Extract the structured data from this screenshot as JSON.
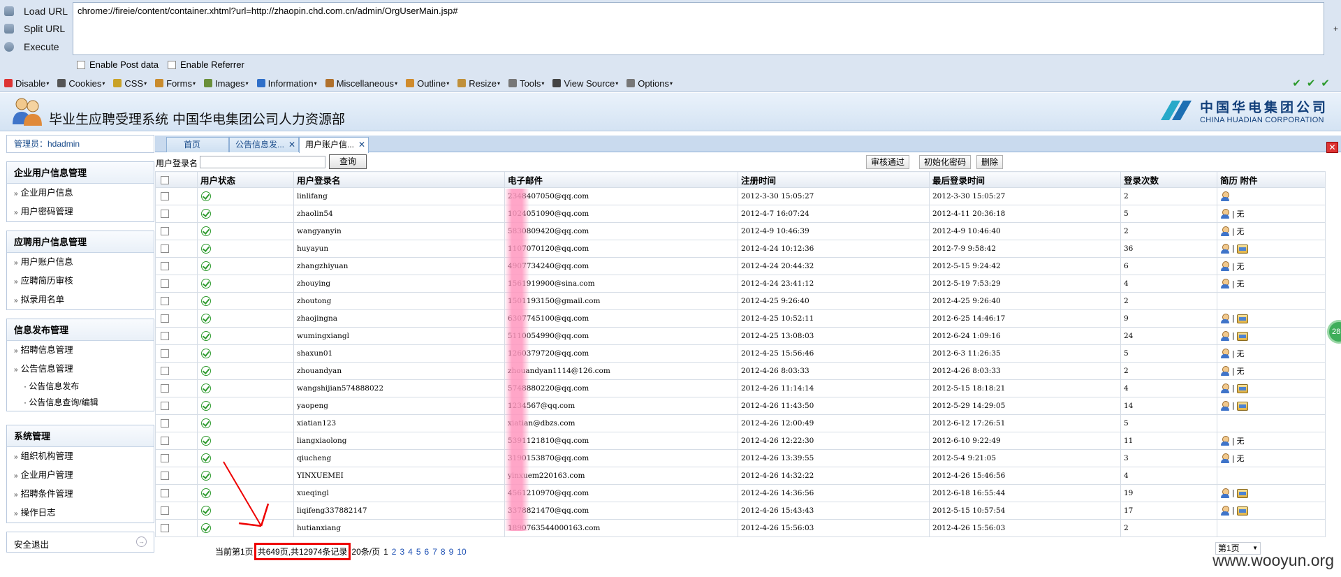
{
  "hackbar": {
    "load_url": "Load URL",
    "split_url": "Split URL",
    "execute": "Execute",
    "url_value": "chrome://fireie/content/container.xhtml?url=http://zhaopin.chd.com.cn/admin/OrgUserMain.jsp#",
    "plus": "+",
    "enable_post": "Enable Post data",
    "enable_referrer": "Enable Referrer"
  },
  "webdev_toolbar": {
    "items": [
      {
        "label": "Disable",
        "color": "#d33"
      },
      {
        "label": "Cookies",
        "color": "#555"
      },
      {
        "label": "CSS",
        "color": "#c9a227"
      },
      {
        "label": "Forms",
        "color": "#c98b2c"
      },
      {
        "label": "Images",
        "color": "#6a8f3a"
      },
      {
        "label": "Information",
        "color": "#2f6fc9"
      },
      {
        "label": "Miscellaneous",
        "color": "#b0702c"
      },
      {
        "label": "Outline",
        "color": "#d08b2c"
      },
      {
        "label": "Resize",
        "color": "#c0903a"
      },
      {
        "label": "Tools",
        "color": "#777"
      },
      {
        "label": "View Source",
        "color": "#444"
      },
      {
        "label": "Options",
        "color": "#777"
      }
    ],
    "checks": "✔✔✔"
  },
  "header": {
    "system_title": "毕业生应聘受理系统  中国华电集团公司人力资源部",
    "brand_cn": "中国华电集团公司",
    "brand_en": "CHINA HUADIAN CORPORATION"
  },
  "sidebar": {
    "admin_label": "管理员：hdadmin",
    "sections": [
      {
        "title": "企业用户信息管理",
        "items": [
          "企业用户信息",
          "用户密码管理"
        ]
      },
      {
        "title": "应聘用户信息管理",
        "items": [
          "用户账户信息",
          "应聘简历审核",
          "拟录用名单"
        ]
      },
      {
        "title": "信息发布管理",
        "items": [
          "招聘信息管理",
          "公告信息管理"
        ],
        "subitems": [
          "· 公告信息发布",
          "· 公告信息查询/编辑"
        ]
      },
      {
        "title": "系统管理",
        "items": [
          "组织机构管理",
          "企业用户管理",
          "招聘条件管理",
          "操作日志"
        ]
      }
    ],
    "logout": "安全退出"
  },
  "tabs": [
    {
      "label": "首页"
    },
    {
      "label": "公告信息发..."
    },
    {
      "label": "用户账户信..."
    }
  ],
  "toolbar": {
    "search_label": "用户登录名",
    "search_value": "",
    "search_btn": "查询",
    "approve_btn": "审核通过",
    "reset_pwd_btn": "初始化密码",
    "delete_btn": "删除"
  },
  "table": {
    "columns": [
      "",
      "用户状态",
      "用户登录名",
      "电子邮件",
      "注册时间",
      "最后登录时间",
      "登录次数",
      "简历 附件"
    ],
    "rows": [
      {
        "login": "linlifang",
        "email": "2348407050@qq.com",
        "reg": "2012-3-30 15:05:27",
        "last": "2012-3-30 15:05:27",
        "count": "2",
        "resume": true,
        "att": ""
      },
      {
        "login": "zhaolin54",
        "email": "1024051090@qq.com",
        "reg": "2012-4-7 16:07:24",
        "last": "2012-4-11 20:36:18",
        "count": "5",
        "resume": true,
        "att": "无"
      },
      {
        "login": "wangyanyin",
        "email": "5830809420@qq.com",
        "reg": "2012-4-9 10:46:39",
        "last": "2012-4-9 10:46:40",
        "count": "2",
        "resume": true,
        "att": "无"
      },
      {
        "login": "huyayun",
        "email": "1107070120@qq.com",
        "reg": "2012-4-24 10:12:36",
        "last": "2012-7-9 9:58:42",
        "count": "36",
        "resume": true,
        "att": "icon"
      },
      {
        "login": "zhangzhiyuan",
        "email": "4907734240@qq.com",
        "reg": "2012-4-24 20:44:32",
        "last": "2012-5-15 9:24:42",
        "count": "6",
        "resume": true,
        "att": "无"
      },
      {
        "login": "zhouying",
        "email": "1561919900@sina.com",
        "reg": "2012-4-24 23:41:12",
        "last": "2012-5-19 7:53:29",
        "count": "4",
        "resume": true,
        "att": "无"
      },
      {
        "login": "zhoutong",
        "email": "1501193150@gmail.com",
        "reg": "2012-4-25 9:26:40",
        "last": "2012-4-25 9:26:40",
        "count": "2",
        "resume": false,
        "att": ""
      },
      {
        "login": "zhaojingna",
        "email": "6307745100@qq.com",
        "reg": "2012-4-25 10:52:11",
        "last": "2012-6-25 14:46:17",
        "count": "9",
        "resume": true,
        "att": "icon"
      },
      {
        "login": "wumingxiangl",
        "email": "5110054990@qq.com",
        "reg": "2012-4-25 13:08:03",
        "last": "2012-6-24 1:09:16",
        "count": "24",
        "resume": true,
        "att": "icon"
      },
      {
        "login": "shaxun01",
        "email": "1260379720@qq.com",
        "reg": "2012-4-25 15:56:46",
        "last": "2012-6-3 11:26:35",
        "count": "5",
        "resume": true,
        "att": "无"
      },
      {
        "login": "zhouandyan",
        "email": "zhouandyan1114@126.com",
        "reg": "2012-4-26 8:03:33",
        "last": "2012-4-26 8:03:33",
        "count": "2",
        "resume": true,
        "att": "无"
      },
      {
        "login": "wangshijian574888022",
        "email": "5748880220@qq.com",
        "reg": "2012-4-26 11:14:14",
        "last": "2012-5-15 18:18:21",
        "count": "4",
        "resume": true,
        "att": "icon"
      },
      {
        "login": "yaopeng",
        "email": "1234567@qq.com",
        "reg": "2012-4-26 11:43:50",
        "last": "2012-5-29 14:29:05",
        "count": "14",
        "resume": true,
        "att": "icon"
      },
      {
        "login": "xiatian123",
        "email": "xiatian@dbzs.com",
        "reg": "2012-4-26 12:00:49",
        "last": "2012-6-12 17:26:51",
        "count": "5",
        "resume": false,
        "att": ""
      },
      {
        "login": "liangxiaolong",
        "email": "5391121810@qq.com",
        "reg": "2012-4-26 12:22:30",
        "last": "2012-6-10 9:22:49",
        "count": "11",
        "resume": true,
        "att": "无"
      },
      {
        "login": "qiucheng",
        "email": "3190153870@qq.com",
        "reg": "2012-4-26 13:39:55",
        "last": "2012-5-4 9:21:05",
        "count": "3",
        "resume": true,
        "att": "无"
      },
      {
        "login": "YINXUEMEI",
        "email": "yinxuem220163.com",
        "reg": "2012-4-26 14:32:22",
        "last": "2012-4-26 15:46:56",
        "count": "4",
        "resume": false,
        "att": ""
      },
      {
        "login": "xueqingl",
        "email": "4561210970@qq.com",
        "reg": "2012-4-26 14:36:56",
        "last": "2012-6-18 16:55:44",
        "count": "19",
        "resume": true,
        "att": "icon"
      },
      {
        "login": "liqifeng337882147",
        "email": "3378821470@qq.com",
        "reg": "2012-4-26 15:43:43",
        "last": "2012-5-15 10:57:54",
        "count": "17",
        "resume": true,
        "att": "icon"
      },
      {
        "login": "hutianxiang",
        "email": "1890763544000163.com",
        "reg": "2012-4-26 15:56:03",
        "last": "2012-4-26 15:56:03",
        "count": "2",
        "resume": false,
        "att": ""
      }
    ]
  },
  "pager": {
    "current": "当前第1页",
    "total_highlight": "共649页,共12974条记录",
    "per_page": "20条/页",
    "pages": [
      "1",
      "2",
      "3",
      "4",
      "5",
      "6",
      "7",
      "8",
      "9",
      "10"
    ],
    "select_value": "第1页"
  },
  "bubble": "28",
  "watermark": "www.wooyun.org"
}
